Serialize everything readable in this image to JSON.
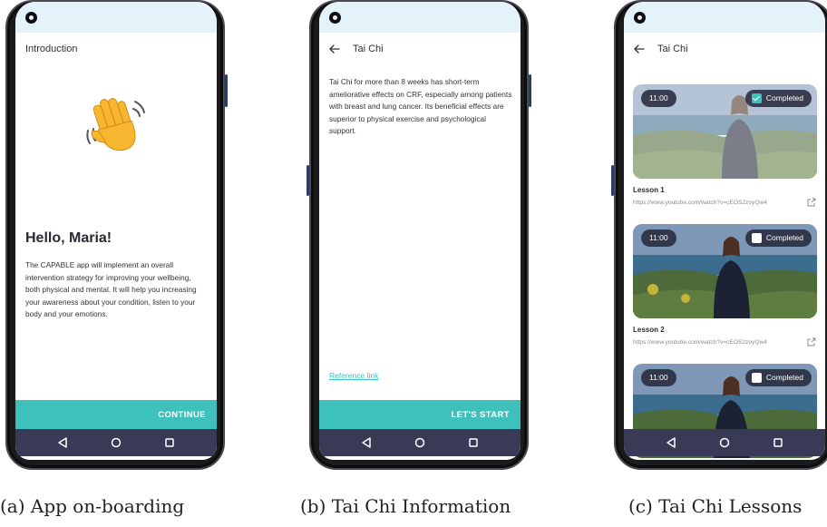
{
  "phones": {
    "onboarding": {
      "title": "Introduction",
      "greeting": "Hello, Maria!",
      "body": "The CAPABLE app will implement an overall intervention strategy for improving your wellbeing, both physical and mental. It will help you increasing your awareness about your condition, listen to your body and your emotions.",
      "cta_label": "CONTINUE",
      "icon": "waving-hand-icon"
    },
    "info": {
      "title": "Tai Chi",
      "body": "Tai Chi for more than 8 weeks has short-term ameliorative effects on CRF, especially among patients with breast and lung cancer. Its beneficial effects are superior to physical exercise and psychological support.",
      "reference_label": "Reference link",
      "cta_label": "LET'S START"
    },
    "lessons": {
      "title": "Tai Chi",
      "items": [
        {
          "duration": "11:00",
          "status": "Completed",
          "completed": true,
          "title": "Lesson 1",
          "url": "https://www.youtube.com/watch?v=cEOS2zoyQw4"
        },
        {
          "duration": "11:00",
          "status": "Completed",
          "completed": false,
          "title": "Lesson 2",
          "url": "https://www.youtube.com/watch?v=cEOS2zoyQw4"
        },
        {
          "duration": "11:00",
          "status": "Completed",
          "completed": false
        }
      ]
    }
  },
  "captions": {
    "a": "(a) App on-boarding",
    "b": "(b) Tai Chi Information",
    "c": "(c) Tai Chi Lessons"
  },
  "colors": {
    "accent": "#3ec1bd",
    "navbar": "#393a55",
    "statusbar": "#e4f3fa"
  }
}
